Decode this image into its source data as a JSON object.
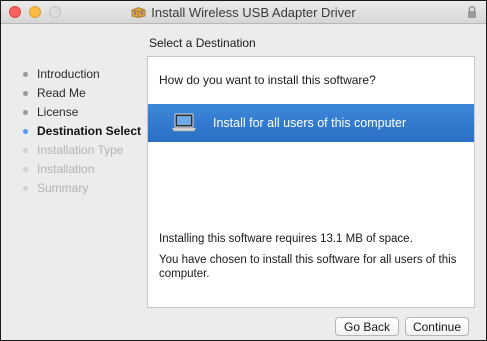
{
  "window": {
    "title": "Install Wireless USB Adapter Driver",
    "title_icon": "package-icon"
  },
  "subtitle": "Select a Destination",
  "sidebar": {
    "steps": [
      {
        "label": "Introduction",
        "state": "done"
      },
      {
        "label": "Read Me",
        "state": "done"
      },
      {
        "label": "License",
        "state": "done"
      },
      {
        "label": "Destination Select",
        "state": "active"
      },
      {
        "label": "Installation Type",
        "state": "future"
      },
      {
        "label": "Installation",
        "state": "future"
      },
      {
        "label": "Summary",
        "state": "future"
      }
    ]
  },
  "main": {
    "question": "How do you want to install this software?",
    "option_label": "Install for all users of this computer",
    "option_icon": "laptop-icon",
    "space_note": "Installing this software requires 13.1 MB of space.",
    "choice_note": "You have chosen to install this software for all users of this computer."
  },
  "buttons": {
    "back": "Go Back",
    "continue": "Continue"
  },
  "colors": {
    "selection": "#2f78cf",
    "active_dot": "#5b9be8",
    "close": "#fc605c",
    "minimize": "#fdbc40"
  }
}
